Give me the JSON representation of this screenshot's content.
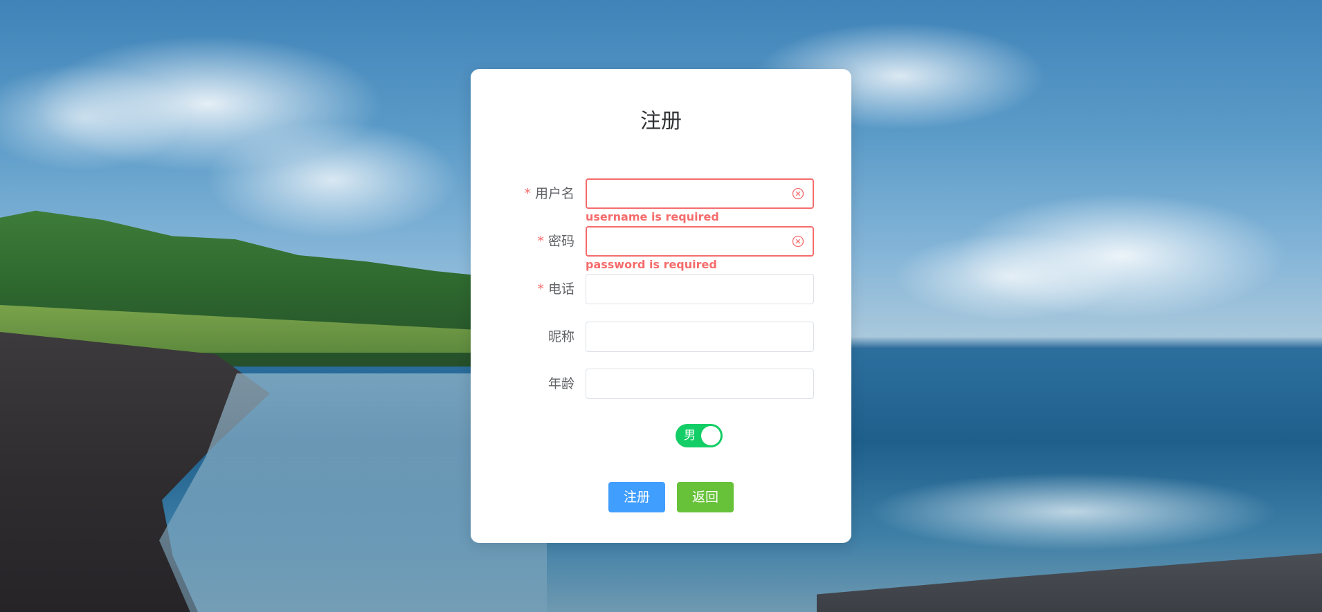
{
  "page": {
    "title": "注册"
  },
  "form": {
    "username": {
      "label": "用户名",
      "required_mark": "*",
      "value": "",
      "error": "username is required"
    },
    "password": {
      "label": "密码",
      "required_mark": "*",
      "value": "",
      "error": "password is required"
    },
    "phone": {
      "label": "电话",
      "required_mark": "*",
      "value": ""
    },
    "nickname": {
      "label": "昵称",
      "value": ""
    },
    "age": {
      "label": "年龄",
      "value": ""
    },
    "gender_switch": {
      "text": "男",
      "checked": true
    }
  },
  "buttons": {
    "register": "注册",
    "back": "返回"
  },
  "colors": {
    "error": "#f56c6c",
    "primary": "#409eff",
    "success": "#67c23a",
    "switch_on": "#13ce66"
  },
  "icons": {
    "clear": "circle-close-icon"
  }
}
